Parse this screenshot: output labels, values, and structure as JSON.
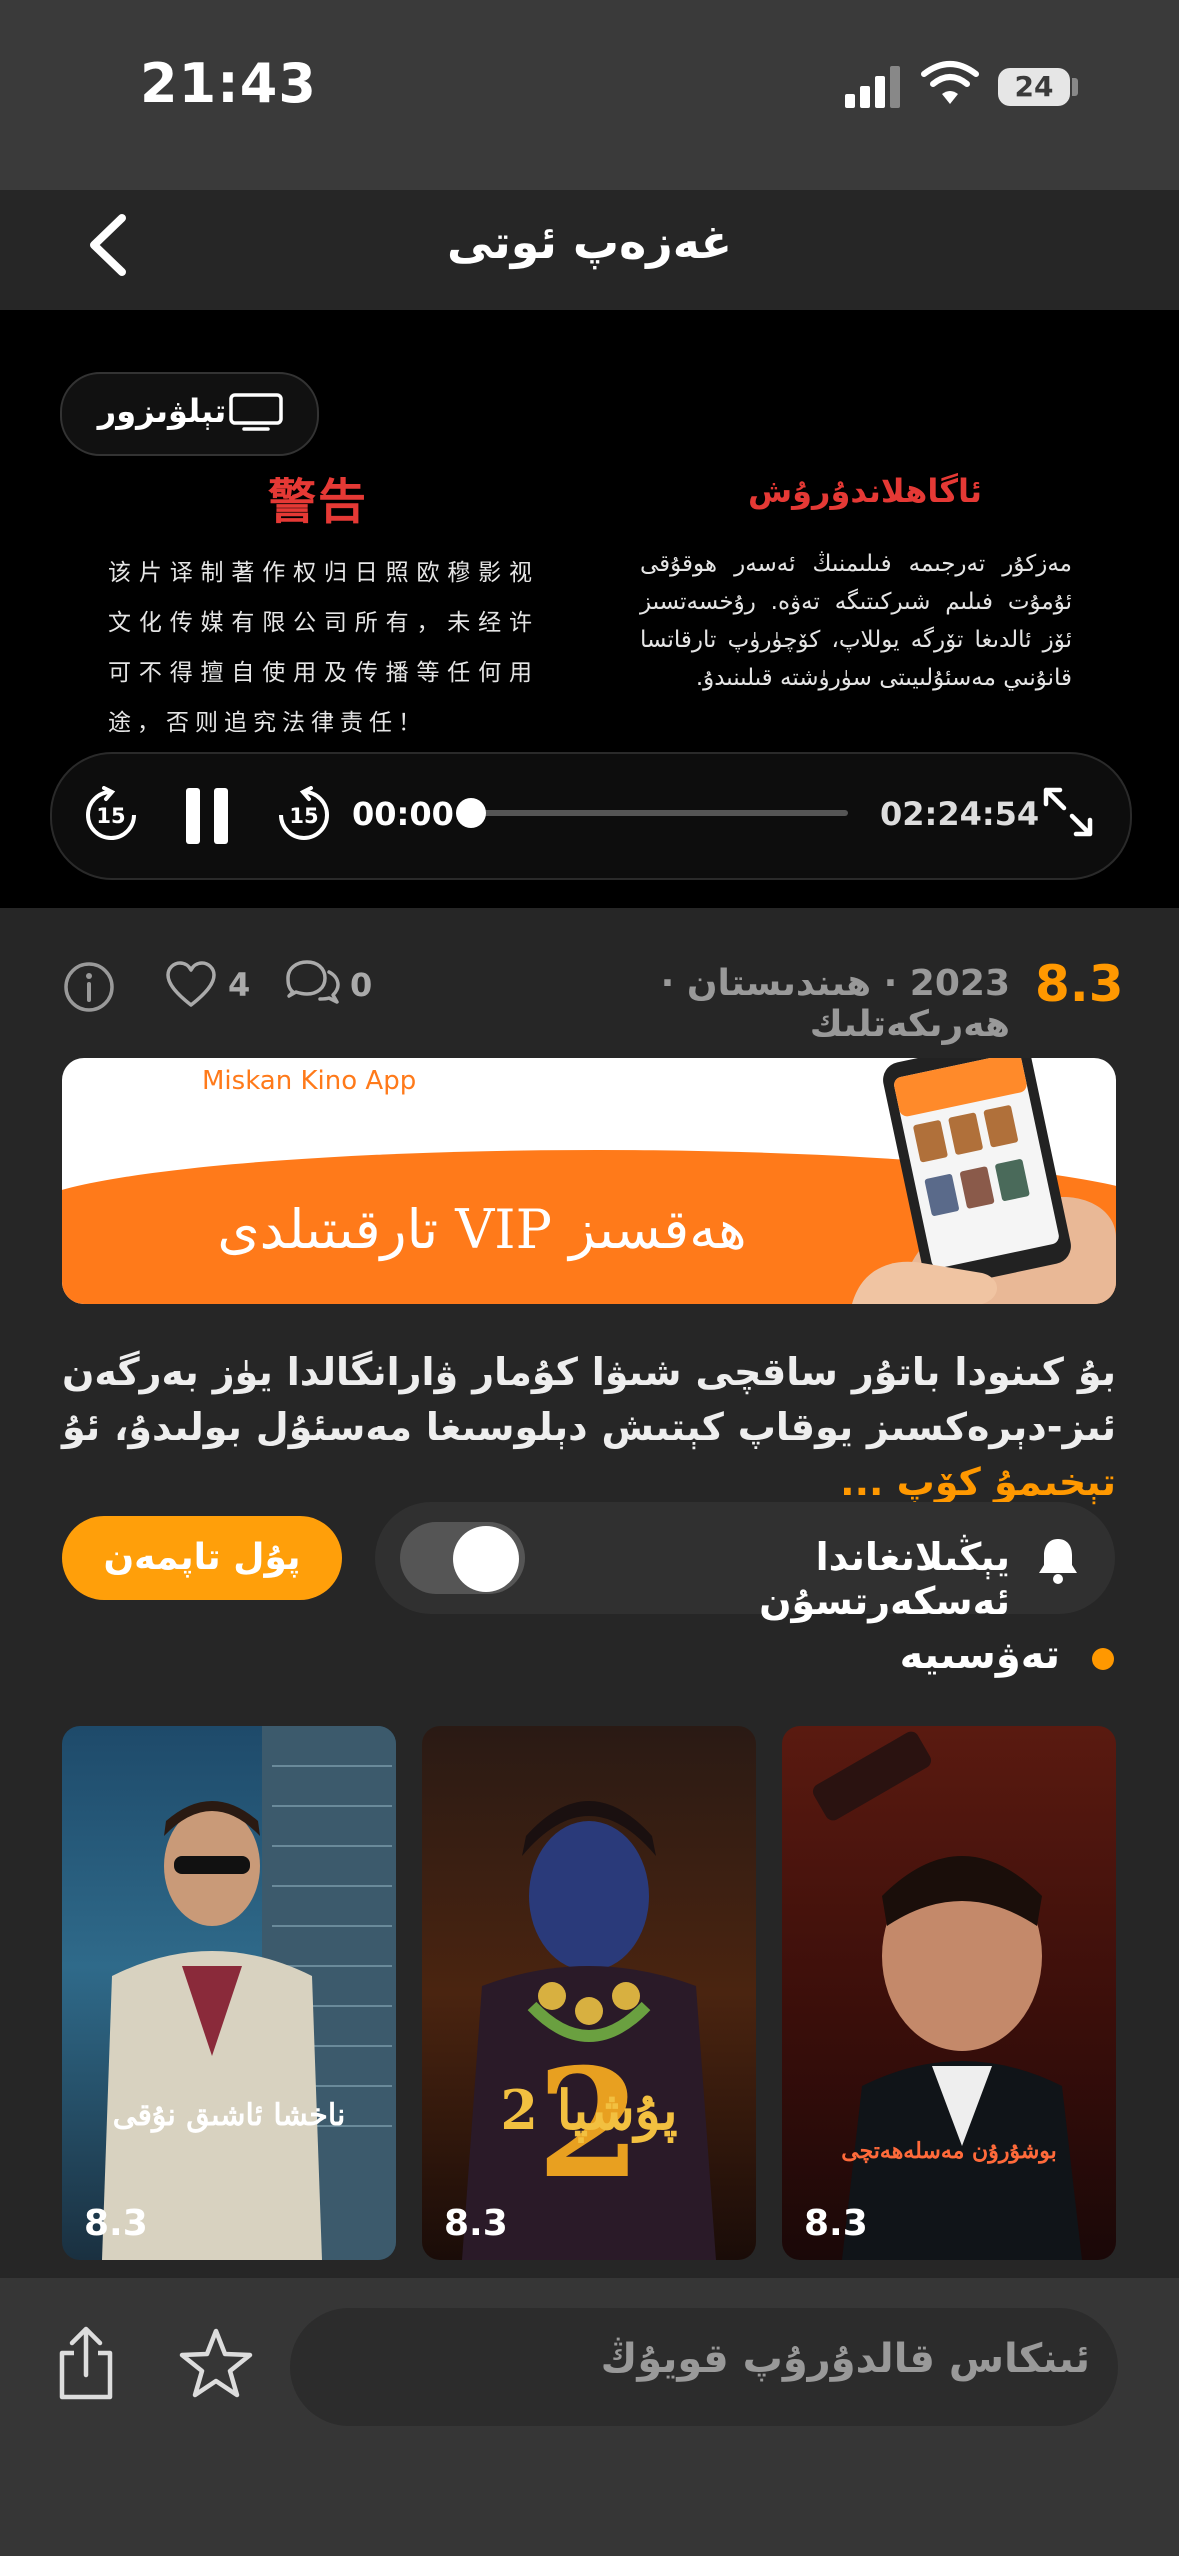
{
  "status_bar": {
    "time": "21:43",
    "battery": "24"
  },
  "nav": {
    "title": "غەزەپ ئوتى"
  },
  "player": {
    "tv_label": "تېلۋىزور",
    "warning_cn_title": "警告",
    "warning_cn_body": "该片译制著作权归日照欧穆影视文化传媒有限公司所有，未经许可不得擅自使用及传播等任何用途，否则追究法律责任！",
    "warning_ug_title": "ئاگاھلاندۇرۇش",
    "warning_ug_body": "مەزكۇر تەرجىمە فىلىمنىڭ ئەسەر ھوقۇقى ئۇمۇت فىلىم شىركىتىگە تەۋە. رۇخسەتسىز ئۆز ئالدىغا تۆرگە يوللاپ، كۆچۈرۈپ تارقاتسا قانۇنىي مەسئۇلىيىتى سۈرۈشتە قىلىنىدۇ.",
    "current_time": "00:00",
    "total_time": "02:24:54",
    "progress": 0,
    "rewind_seconds": "15",
    "forward_seconds": "15"
  },
  "meta": {
    "rating": "8.3",
    "info_line": "2023 · ھىندىستان · ھەرىكەتلىك",
    "likes": "4",
    "comments": "0"
  },
  "banner": {
    "app_name": "Miskan Kino App",
    "title": "ھەقسىز VIP تارقىتىلدى"
  },
  "description": {
    "text": "بۇ كىنودا باتۇر ساقچى شىۋا كۇمار ۋارانگالدا يۈز بەرگەن ئىز-دېرەكسىز يوقاپ كېتىش دېلوسىغا مەسئۇل بولىدۇ، ئۇ",
    "more_label": "تېخىمۇ كۆپ ..."
  },
  "notify": {
    "label": "يېڭىلانغاندا ئەسكەرتسۇن",
    "enabled": false
  },
  "pay_button": "پۇل تاپمەن",
  "recommend": {
    "title": "تەۋسىيە",
    "items": [
      {
        "rating": "8.3",
        "caption": "بوشۇرۇن مەسلەھەتچى"
      },
      {
        "rating": "8.3",
        "caption": "پۇشپا 2"
      },
      {
        "rating": "8.3",
        "caption": "ناخشا ئاشىق نۇقى"
      }
    ]
  },
  "bottom": {
    "comment_placeholder": "ئىنكاس قالدۇرۇپ قويۇڭ"
  }
}
